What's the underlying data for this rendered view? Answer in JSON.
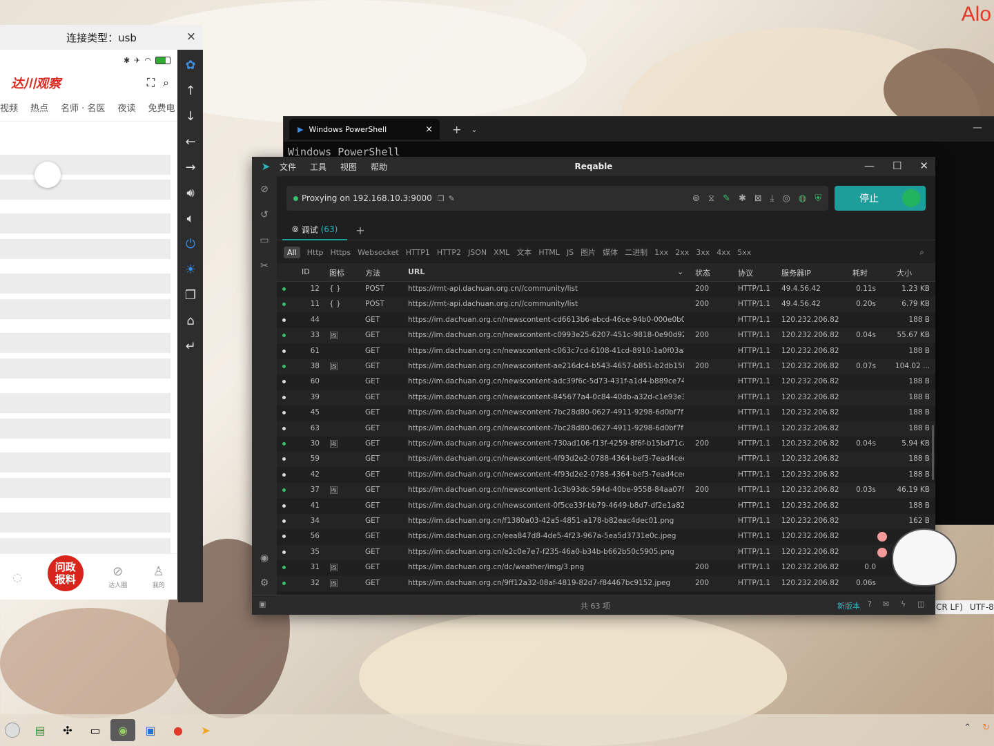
{
  "corner_text": "Alo",
  "phone": {
    "title": "连接类型：usb",
    "close": "×",
    "app": {
      "brand": "达川观察",
      "tabs": [
        "视频",
        "热点",
        "名师 · 名医",
        "夜读",
        "免费电"
      ],
      "tabbar": {
        "report_label": "问政\n报料",
        "items": [
          "达人圈",
          "我的"
        ]
      }
    }
  },
  "side_tools": [
    "paw-icon",
    "arrow-up-icon",
    "arrow-down-icon",
    "arrow-left-icon",
    "arrow-right-icon",
    "volume-up-icon",
    "volume-down-icon",
    "power-icon",
    "bulb-icon",
    "copy-icon",
    "home-icon",
    "back-icon"
  ],
  "powershell": {
    "tab_title": "Windows PowerShell",
    "text": "Windows PowerShell",
    "status": [
      "CR LF)",
      "UTF-8"
    ]
  },
  "reqable": {
    "title": "Reqable",
    "menu": [
      "文件",
      "工具",
      "视图",
      "帮助"
    ],
    "proxy_text": "Proxying on 192.168.10.3:9000",
    "stop_label": "停止",
    "session_tab": "调试",
    "session_count": "(63)",
    "filters": [
      "All",
      "Http",
      "Https",
      "Websocket",
      "HTTP1",
      "HTTP2",
      "JSON",
      "XML",
      "文本",
      "HTML",
      "JS",
      "图片",
      "媒体",
      "二进制",
      "1xx",
      "2xx",
      "3xx",
      "4xx",
      "5xx"
    ],
    "columns": {
      "id": "ID",
      "icon": "图标",
      "method": "方法",
      "url": "URL",
      "status": "状态",
      "protocol": "协议",
      "server_ip": "服务器IP",
      "duration": "耗时",
      "size": "大小"
    },
    "rows": [
      {
        "id": "12",
        "icon": "{ }",
        "method": "POST",
        "url": "https://rmt-api.dachuan.org.cn//community/list",
        "status": "200",
        "protocol": "HTTP/1.1",
        "ip": "49.4.56.42",
        "time": "0.11s",
        "size": "1.23 KB",
        "done": true
      },
      {
        "id": "11",
        "icon": "{ }",
        "method": "POST",
        "url": "https://rmt-api.dachuan.org.cn//community/list",
        "status": "200",
        "protocol": "HTTP/1.1",
        "ip": "49.4.56.42",
        "time": "0.20s",
        "size": "6.79 KB",
        "done": true
      },
      {
        "id": "44",
        "icon": "",
        "method": "GET",
        "url": "https://im.dachuan.org.cn/newscontent-cd6613b6-ebcd-46ce-94b0-000e0b000...",
        "status": "",
        "protocol": "HTTP/1.1",
        "ip": "120.232.206.82",
        "time": "",
        "size": "188 B",
        "done": false
      },
      {
        "id": "33",
        "icon": "img",
        "method": "GET",
        "url": "https://im.dachuan.org.cn/newscontent-c0993e25-6207-451c-9818-0e90d921d...",
        "status": "200",
        "protocol": "HTTP/1.1",
        "ip": "120.232.206.82",
        "time": "0.04s",
        "size": "55.67 KB",
        "done": true
      },
      {
        "id": "61",
        "icon": "",
        "method": "GET",
        "url": "https://im.dachuan.org.cn/newscontent-c063c7cd-6108-41cd-8910-1a0f03a853...",
        "status": "",
        "protocol": "HTTP/1.1",
        "ip": "120.232.206.82",
        "time": "",
        "size": "188 B",
        "done": false
      },
      {
        "id": "38",
        "icon": "img",
        "method": "GET",
        "url": "https://im.dachuan.org.cn/newscontent-ae216dc4-b543-4657-b851-b2db158ad...",
        "status": "200",
        "protocol": "HTTP/1.1",
        "ip": "120.232.206.82",
        "time": "0.07s",
        "size": "104.02 ...",
        "done": true
      },
      {
        "id": "60",
        "icon": "",
        "method": "GET",
        "url": "https://im.dachuan.org.cn/newscontent-adc39f6c-5d73-431f-a1d4-b889ce7457...",
        "status": "",
        "protocol": "HTTP/1.1",
        "ip": "120.232.206.82",
        "time": "",
        "size": "188 B",
        "done": false
      },
      {
        "id": "39",
        "icon": "",
        "method": "GET",
        "url": "https://im.dachuan.org.cn/newscontent-845677a4-0c84-40db-a32d-c1e93e3cec...",
        "status": "",
        "protocol": "HTTP/1.1",
        "ip": "120.232.206.82",
        "time": "",
        "size": "188 B",
        "done": false
      },
      {
        "id": "45",
        "icon": "",
        "method": "GET",
        "url": "https://im.dachuan.org.cn/newscontent-7bc28d80-0627-4911-9298-6d0bf7f7c2...",
        "status": "",
        "protocol": "HTTP/1.1",
        "ip": "120.232.206.82",
        "time": "",
        "size": "188 B",
        "done": false
      },
      {
        "id": "63",
        "icon": "",
        "method": "GET",
        "url": "https://im.dachuan.org.cn/newscontent-7bc28d80-0627-4911-9298-6d0bf7f7c2...",
        "status": "",
        "protocol": "HTTP/1.1",
        "ip": "120.232.206.82",
        "time": "",
        "size": "188 B",
        "done": false
      },
      {
        "id": "30",
        "icon": "img",
        "method": "GET",
        "url": "https://im.dachuan.org.cn/newscontent-730ad106-f13f-4259-8f6f-b15bd71ca56...",
        "status": "200",
        "protocol": "HTTP/1.1",
        "ip": "120.232.206.82",
        "time": "0.04s",
        "size": "5.94 KB",
        "done": true
      },
      {
        "id": "59",
        "icon": "",
        "method": "GET",
        "url": "https://im.dachuan.org.cn/newscontent-4f93d2e2-0788-4364-bef3-7ead4cee2b...",
        "status": "",
        "protocol": "HTTP/1.1",
        "ip": "120.232.206.82",
        "time": "",
        "size": "188 B",
        "done": false
      },
      {
        "id": "42",
        "icon": "",
        "method": "GET",
        "url": "https://im.dachuan.org.cn/newscontent-4f93d2e2-0788-4364-bef3-7ead4cee2b...",
        "status": "",
        "protocol": "HTTP/1.1",
        "ip": "120.232.206.82",
        "time": "",
        "size": "188 B",
        "done": false
      },
      {
        "id": "37",
        "icon": "img",
        "method": "GET",
        "url": "https://im.dachuan.org.cn/newscontent-1c3b93dc-594d-40be-9558-84aa07fa6f...",
        "status": "200",
        "protocol": "HTTP/1.1",
        "ip": "120.232.206.82",
        "time": "0.03s",
        "size": "46.19 KB",
        "done": true
      },
      {
        "id": "41",
        "icon": "",
        "method": "GET",
        "url": "https://im.dachuan.org.cn/newscontent-0f5ce33f-bb79-4649-b8d7-df2e1a829c...",
        "status": "",
        "protocol": "HTTP/1.1",
        "ip": "120.232.206.82",
        "time": "",
        "size": "188 B",
        "done": false
      },
      {
        "id": "34",
        "icon": "",
        "method": "GET",
        "url": "https://im.dachuan.org.cn/f1380a03-42a5-4851-a178-b82eac4dec01.png",
        "status": "",
        "protocol": "HTTP/1.1",
        "ip": "120.232.206.82",
        "time": "",
        "size": "162 B",
        "done": false
      },
      {
        "id": "56",
        "icon": "",
        "method": "GET",
        "url": "https://im.dachuan.org.cn/eea847d8-4de5-4f23-967a-5ea5d3731e0c.jpeg",
        "status": "",
        "protocol": "HTTP/1.1",
        "ip": "120.232.206.82",
        "time": "",
        "size": "",
        "done": false
      },
      {
        "id": "35",
        "icon": "",
        "method": "GET",
        "url": "https://im.dachuan.org.cn/e2c0e7e7-f235-46a0-b34b-b662b50c5905.png",
        "status": "",
        "protocol": "HTTP/1.1",
        "ip": "120.232.206.82",
        "time": "",
        "size": "",
        "done": false
      },
      {
        "id": "31",
        "icon": "img",
        "method": "GET",
        "url": "https://im.dachuan.org.cn/dc/weather/img/3.png",
        "status": "200",
        "protocol": "HTTP/1.1",
        "ip": "120.232.206.82",
        "time": "0.0",
        "size": "",
        "done": true
      },
      {
        "id": "32",
        "icon": "img",
        "method": "GET",
        "url": "https://im.dachuan.org.cn/9ff12a32-08af-4819-82d7-f84467bc9152.jpeg",
        "status": "200",
        "protocol": "HTTP/1.1",
        "ip": "120.232.206.82",
        "time": "0.06s",
        "size": "",
        "done": true
      }
    ],
    "footer_count": "共 63 项",
    "footer_update": "新版本"
  },
  "taskbar": {
    "apps": [
      "circle-app-icon",
      "image-viewer-icon",
      "puzzle-icon",
      "terminal-icon",
      "android-icon",
      "webstorm-icon",
      "record-icon",
      "reqable-icon"
    ],
    "tray": [
      "chevron-up-icon",
      "refresh-icon"
    ]
  }
}
